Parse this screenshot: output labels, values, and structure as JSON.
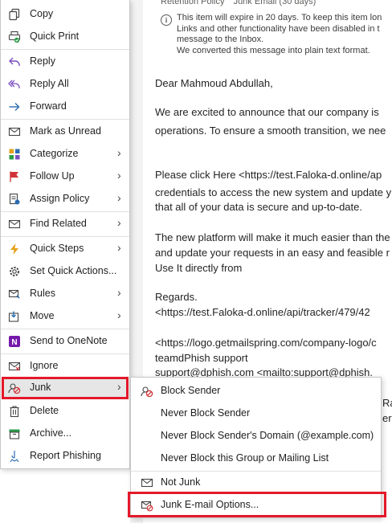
{
  "email": {
    "retention_label": "Retention Policy",
    "retention_value": "Junk Email (30 days)",
    "info_lines": [
      "This item will expire in 20 days. To keep this item lon",
      "Links and other functionality have been disabled in t",
      "message to the Inbox.",
      "We converted this message into plain text format."
    ],
    "body_lines": [
      "Dear Mahmoud Abdullah,",
      "We are excited to announce that our company is",
      "operations. To ensure a smooth transition, we nee",
      "Please click Here <https://test.Faloka-d.online/ap",
      "credentials to access the new system and update y",
      "that all of your data is secure and up-to-date.",
      "The new platform will make it much easier than the",
      "and update your requests in an easy and feasible r",
      "Use It directly from",
      "Regards.",
      "  <https://test.Faloka-d.online/api/tracker/479/42",
      " <https://logo.getmailspring.com/company-logo/c",
      "teamdPhish support",
      "support@dphish.com <mailto:support@dphish.",
      "Ra",
      "er%"
    ]
  },
  "context_menu": {
    "items": [
      {
        "label": "Copy",
        "icon": "copy-icon"
      },
      {
        "label": "Quick Print",
        "icon": "quick-print-icon"
      },
      {
        "label": "Reply",
        "icon": "reply-icon"
      },
      {
        "label": "Reply All",
        "icon": "reply-all-icon"
      },
      {
        "label": "Forward",
        "icon": "forward-icon"
      },
      {
        "label": "Mark as Unread",
        "icon": "envelope-icon"
      },
      {
        "label": "Categorize",
        "icon": "categorize-icon"
      },
      {
        "label": "Follow Up",
        "icon": "flag-icon"
      },
      {
        "label": "Assign Policy",
        "icon": "policy-icon"
      },
      {
        "label": "Find Related",
        "icon": "find-related-icon"
      },
      {
        "label": "Quick Steps",
        "icon": "lightning-icon"
      },
      {
        "label": "Set Quick Actions...",
        "icon": "gear-icon"
      },
      {
        "label": "Rules",
        "icon": "rules-icon"
      },
      {
        "label": "Move",
        "icon": "move-icon"
      },
      {
        "label": "Send to OneNote",
        "icon": "onenote-icon"
      },
      {
        "label": "Ignore",
        "icon": "ignore-icon"
      },
      {
        "label": "Junk",
        "icon": "junk-icon"
      },
      {
        "label": "Delete",
        "icon": "trash-icon"
      },
      {
        "label": "Archive...",
        "icon": "archive-icon"
      },
      {
        "label": "Report Phishing",
        "icon": "phishing-icon"
      }
    ]
  },
  "junk_submenu": {
    "items": [
      {
        "label": "Block Sender",
        "icon": "block-sender-icon"
      },
      {
        "label": "Never Block Sender",
        "icon": ""
      },
      {
        "label": "Never Block Sender's Domain (@example.com)",
        "icon": ""
      },
      {
        "label": "Never Block this Group or Mailing List",
        "icon": ""
      },
      {
        "label": "Not Junk",
        "icon": "envelope-icon"
      },
      {
        "label": "Junk E-mail Options...",
        "icon": "junk-options-icon"
      }
    ]
  },
  "colors": {
    "highlight_border": "#e3192a",
    "accent_blue": "#2b6cb0",
    "flag_red": "#d13438",
    "onenote_purple": "#7719aa"
  }
}
